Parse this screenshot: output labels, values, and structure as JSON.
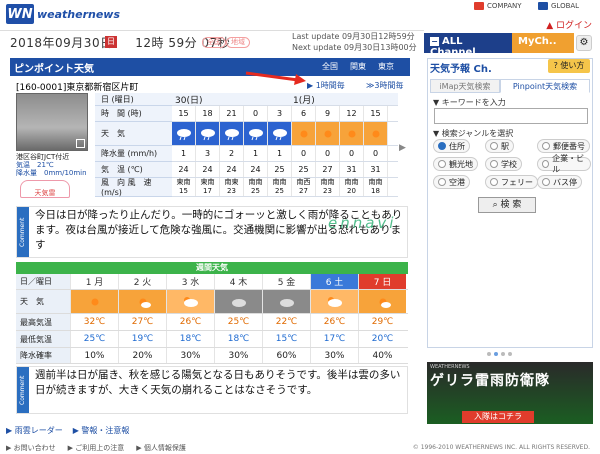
{
  "header": {
    "logo_text": "weathernews",
    "logo_mark": "WN",
    "company_link": "COMPANY",
    "global_link": "GLOBAL",
    "login_link": "ログイン"
  },
  "datebar": {
    "date": "2018年09月30日",
    "day": "日",
    "time": "12時 59分 07秒",
    "pill1": "全国",
    "pill2": "地域",
    "last_update": "Last update  09月30日12時59分",
    "next_update": "Next update  09月30日13時00分"
  },
  "channels": {
    "all": "ALL Channel",
    "my": "MyCh..",
    "gear_icon": "gear-icon"
  },
  "pinpoint": {
    "title": "ピンポイント天気",
    "crumbs": [
      "全国",
      "関東",
      "東京"
    ],
    "address": "[160-0001]東京都新宿区片町",
    "step1": "1時間毎",
    "step3": "3時間毎",
    "camera_name": "港区谷町JCT付近",
    "camera_temp": "気温　21℃",
    "camera_rain": "降水量　0mm/10min",
    "sunset_label": "天気雷"
  },
  "hourly": {
    "labels": [
      "日 (曜日)",
      "時　間 (時)",
      "天　気",
      "降水量 (mm/h)",
      "気　温 (℃)",
      "風　向 風　速(m/s)"
    ],
    "day_row": [
      "30(日)",
      "1(月)"
    ],
    "hours": [
      "15",
      "18",
      "21",
      "0",
      "3",
      "6",
      "9",
      "12",
      "15"
    ],
    "weather": [
      "rain",
      "rain",
      "rain",
      "rain",
      "rain",
      "sun",
      "sun",
      "sun",
      "sun"
    ],
    "precip": [
      "1",
      "3",
      "2",
      "1",
      "1",
      "0",
      "0",
      "0",
      "0"
    ],
    "temps": [
      "24",
      "24",
      "24",
      "24",
      "25",
      "25",
      "27",
      "31",
      "31"
    ],
    "wind_dir": [
      "東南",
      "東南",
      "南東",
      "南南",
      "南南",
      "南西",
      "南南",
      "南南",
      "南南"
    ],
    "wind_speed": [
      "15",
      "17",
      "23",
      "25",
      "25",
      "27",
      "23",
      "20",
      "18"
    ]
  },
  "comment1": "今日は日が降ったり止んだり。一時的にゴォーッと激しく雨が降ることもあります。夜は台風が接近して危険な強風に。交通機関に影響が出る恐れもあります",
  "watermark": "ennavi",
  "weekly": {
    "header": "週間天気",
    "labels": [
      "日／曜日",
      "天　気",
      "最高気温",
      "最低気温",
      "降水確率"
    ],
    "days": [
      "1 月",
      "2 火",
      "3 水",
      "4 木",
      "5 金",
      "6 土",
      "7 日"
    ],
    "day_colors": [
      "#333",
      "#333",
      "#333",
      "#333",
      "#333",
      "#fff",
      "#fff"
    ],
    "day_bgs": [
      "#fff",
      "#fff",
      "#fff",
      "#fff",
      "#fff",
      "#3a79d9",
      "#e03c2c"
    ],
    "weather": [
      "sun",
      "sun-cloud",
      "cloud-sun",
      "cloud",
      "cloud",
      "cloud-sun",
      "sun-cloud"
    ],
    "highs": [
      "32℃",
      "27℃",
      "26℃",
      "25℃",
      "22℃",
      "26℃",
      "29℃"
    ],
    "lows": [
      "25℃",
      "19℃",
      "18℃",
      "18℃",
      "15℃",
      "17℃",
      "20℃"
    ],
    "precip": [
      "10%",
      "20%",
      "30%",
      "30%",
      "60%",
      "30%",
      "40%"
    ],
    "high_color": "#e06a00",
    "low_color": "#1e6ad0"
  },
  "comment2": "週前半は日が届き、秋を感じる陽気となる日もありそうです。後半は雲の多い日が続きますが、大きく天気の崩れることはなさそうです。",
  "bottom": {
    "radar": "雨雲レーダー",
    "warning": "警報・注意報"
  },
  "footer": {
    "links": [
      "お問い合わせ",
      "ご利用上の注意",
      "個人情報保護"
    ],
    "copyright": "© 1996-2010 WEATHERNEWS INC. ALL RIGHTS RESERVED."
  },
  "right": {
    "title": "天気予報 Ch.",
    "use_btn": "使い方",
    "tab1": "iMap天気検索",
    "tab2": "Pinpoint天気検索",
    "kw_label": "▼ キーワードを入力",
    "genre_label": "▼ 検索ジャンルを選択",
    "genres": [
      "住所",
      "駅",
      "郵便番号",
      "観光地",
      "学校",
      "企業・ビル",
      "空港",
      "フェリー",
      "バス停"
    ],
    "search_btn": "検 索",
    "ad_sub": "WEATHERNEWS",
    "ad_title": "ゲリラ雷雨防衛隊",
    "ad_btn": "入隊はコチラ"
  }
}
